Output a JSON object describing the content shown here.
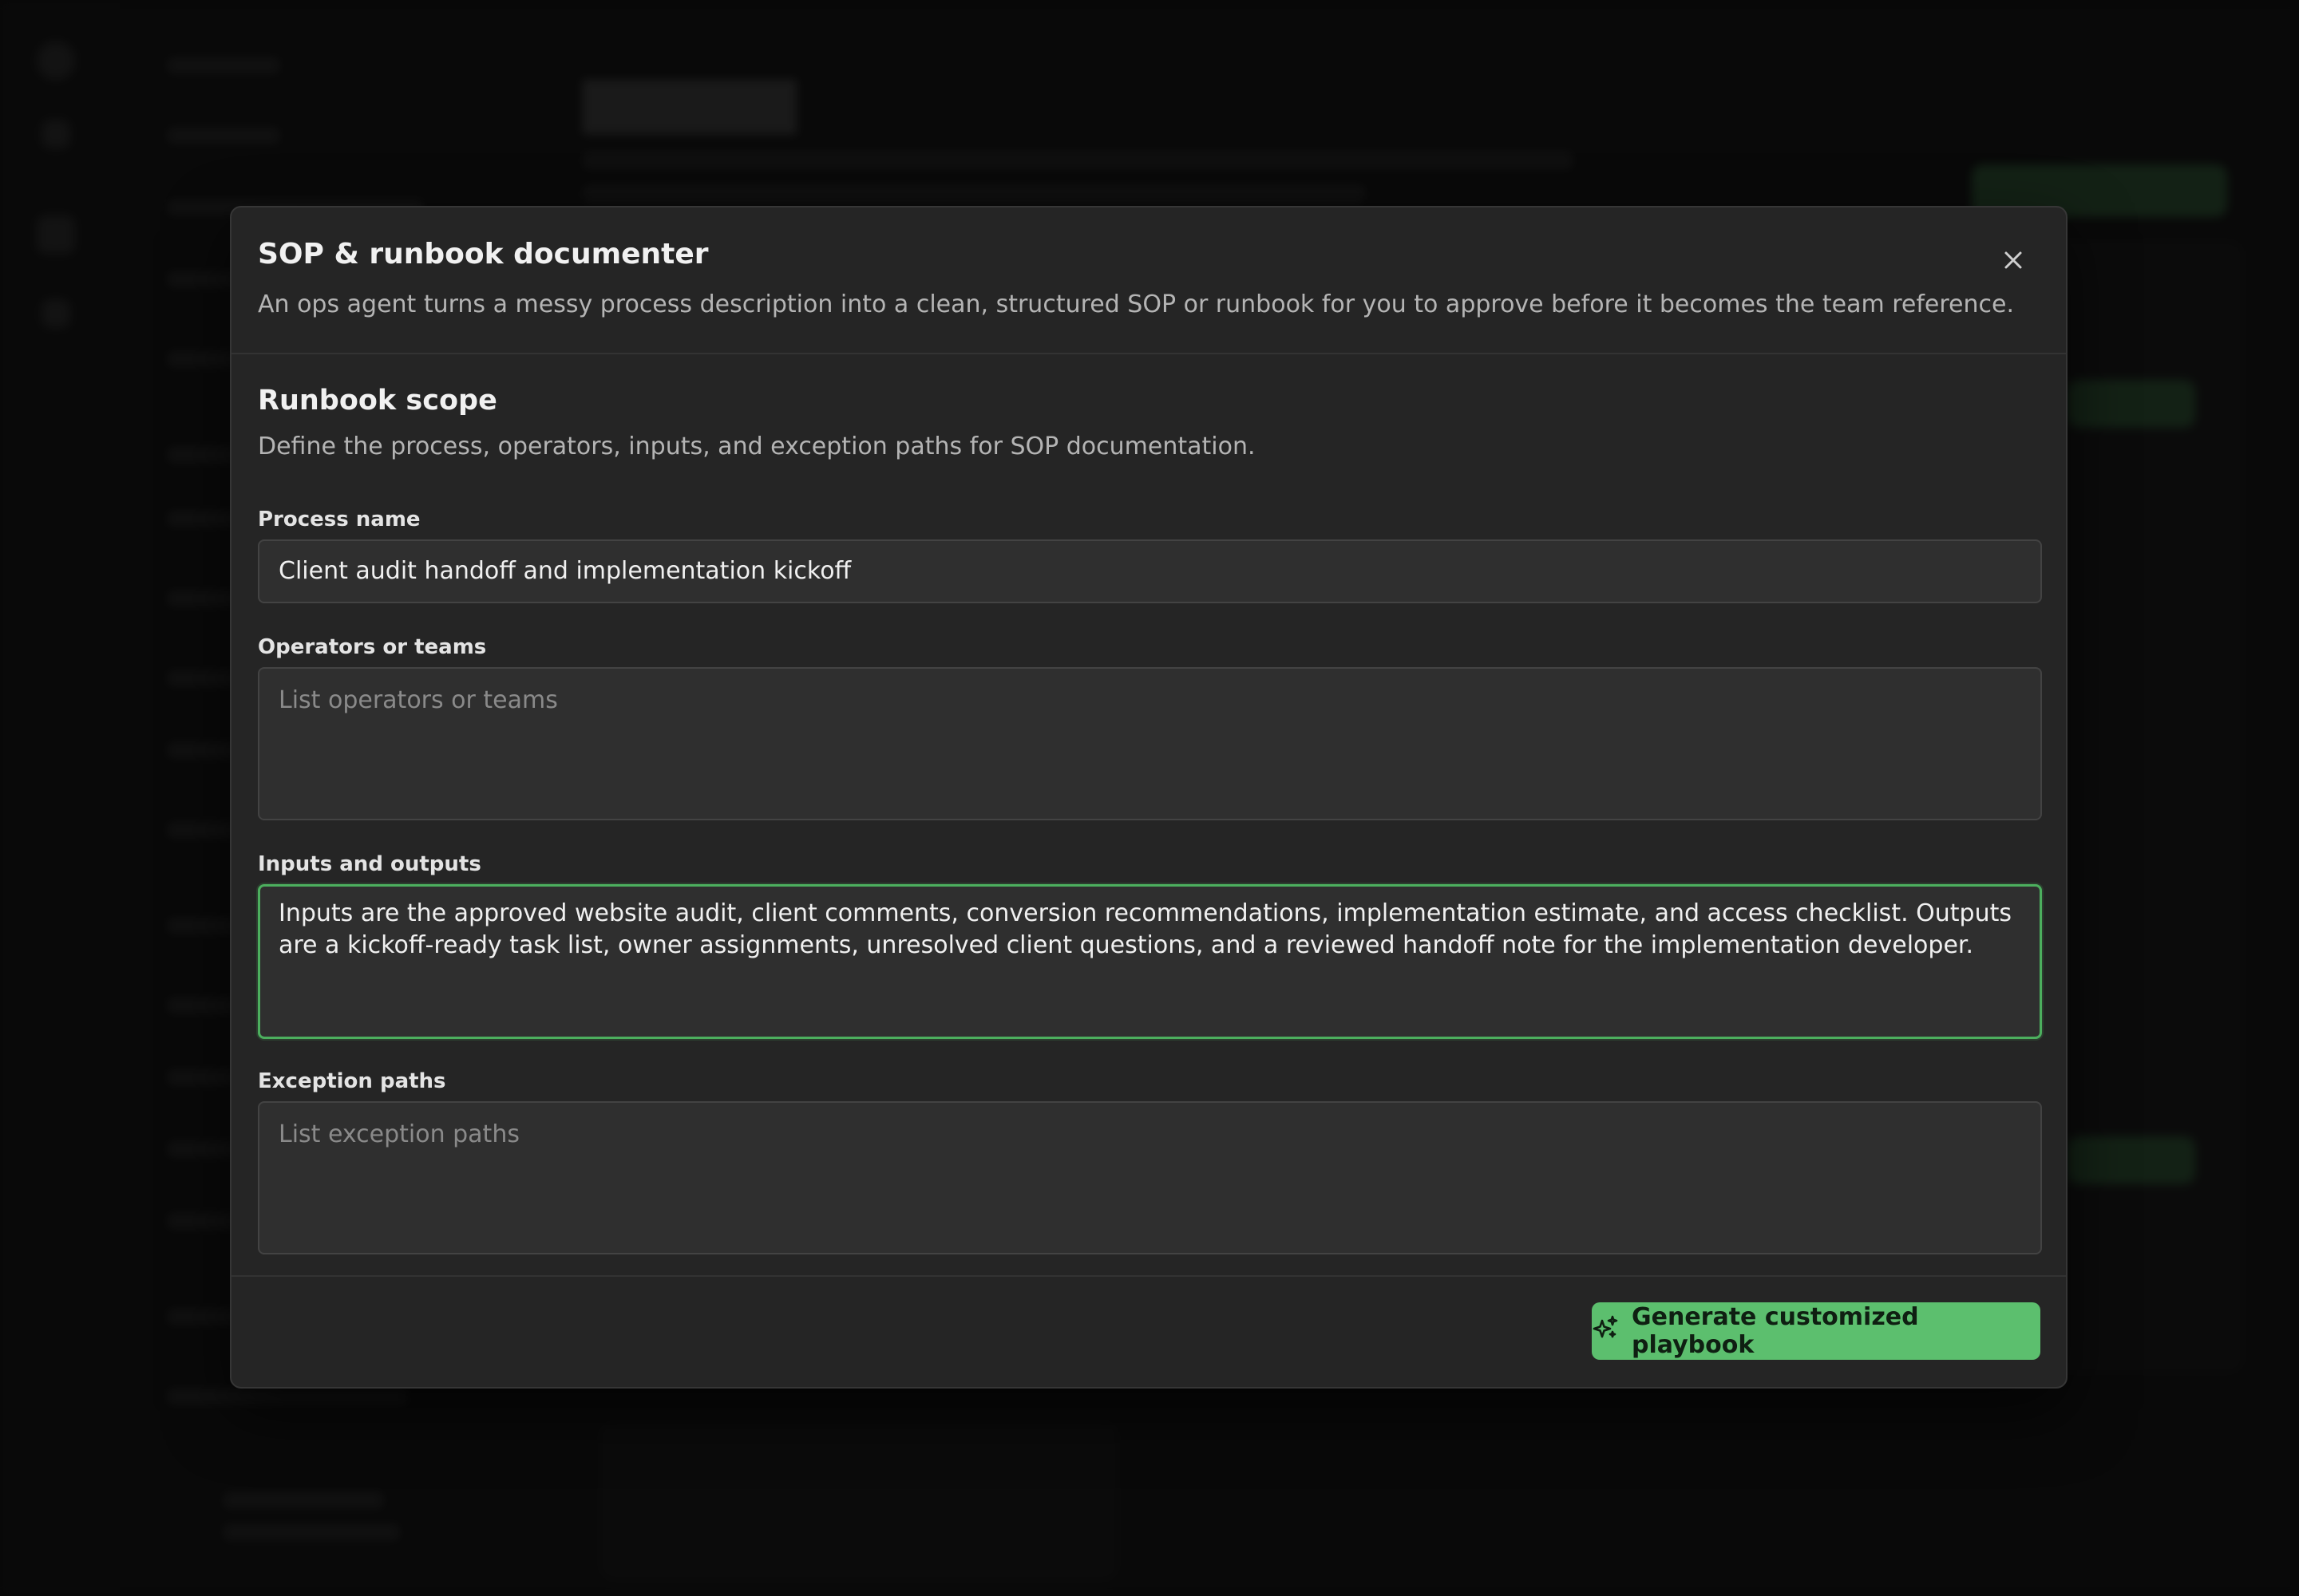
{
  "modal": {
    "title": "SOP & runbook documenter",
    "description": "An ops agent turns a messy process description into a clean, structured SOP or runbook for you to approve before it becomes the team reference.",
    "close_icon": "close-icon"
  },
  "section": {
    "title": "Runbook scope",
    "description": "Define the process, operators, inputs, and exception paths for SOP documentation."
  },
  "fields": {
    "process_name": {
      "label": "Process name",
      "value": "Client audit handoff and implementation kickoff"
    },
    "operators": {
      "label": "Operators or teams",
      "placeholder": "List operators or teams",
      "value": ""
    },
    "inputs_outputs": {
      "label": "Inputs and outputs",
      "value": "Inputs are the approved website audit, client comments, conversion recommendations, implementation estimate, and access checklist. Outputs are a kickoff-ready task list, owner assignments, unresolved client questions, and a reviewed handoff note for the implementation developer."
    },
    "exceptions": {
      "label": "Exception paths",
      "placeholder": "List exception paths",
      "value": ""
    }
  },
  "footer": {
    "generate_label": "Generate customized playbook",
    "generate_icon": "sparkles-icon"
  },
  "colors": {
    "accent": "#5cbf6e",
    "focus_border": "#4caf5e",
    "modal_bg": "#252525",
    "field_bg": "#2f2f2f"
  }
}
